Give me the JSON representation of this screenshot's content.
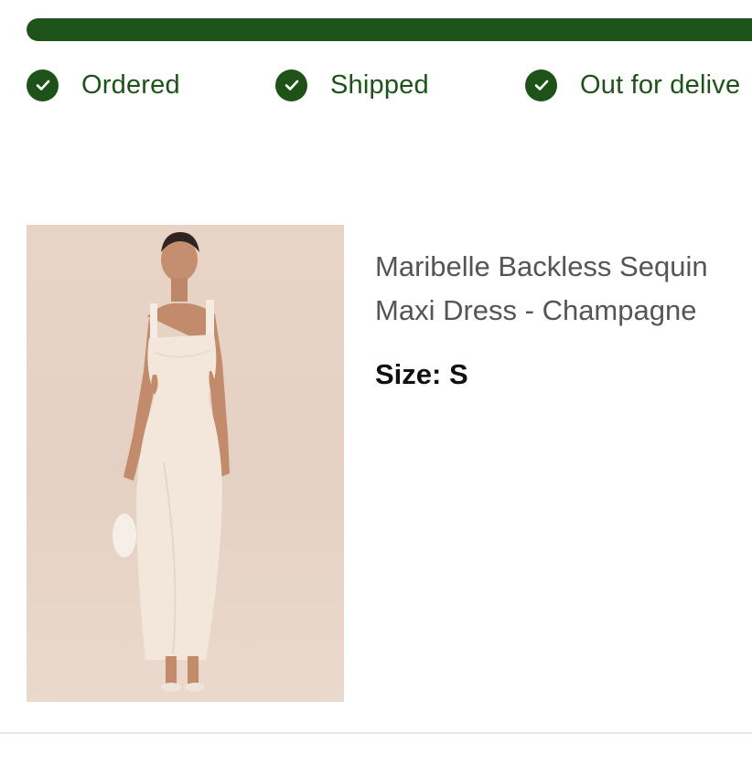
{
  "tracking": {
    "progress_percent": 100,
    "fill_color": "#1d5318",
    "steps": [
      {
        "label": "Ordered",
        "icon": "check-circle-icon",
        "completed": true
      },
      {
        "label": "Shipped",
        "icon": "check-circle-icon",
        "completed": true
      },
      {
        "label": "Out for delive",
        "icon": "check-circle-icon",
        "completed": true
      }
    ]
  },
  "product": {
    "name": "Maribelle Backless Sequin Maxi Dress - Champagne",
    "size_text": "Size: S",
    "image_description_icon": "product-photo"
  },
  "colors": {
    "brand_green": "#1d5318",
    "product_text": "#555555",
    "image_background": "#e8d3c7"
  }
}
